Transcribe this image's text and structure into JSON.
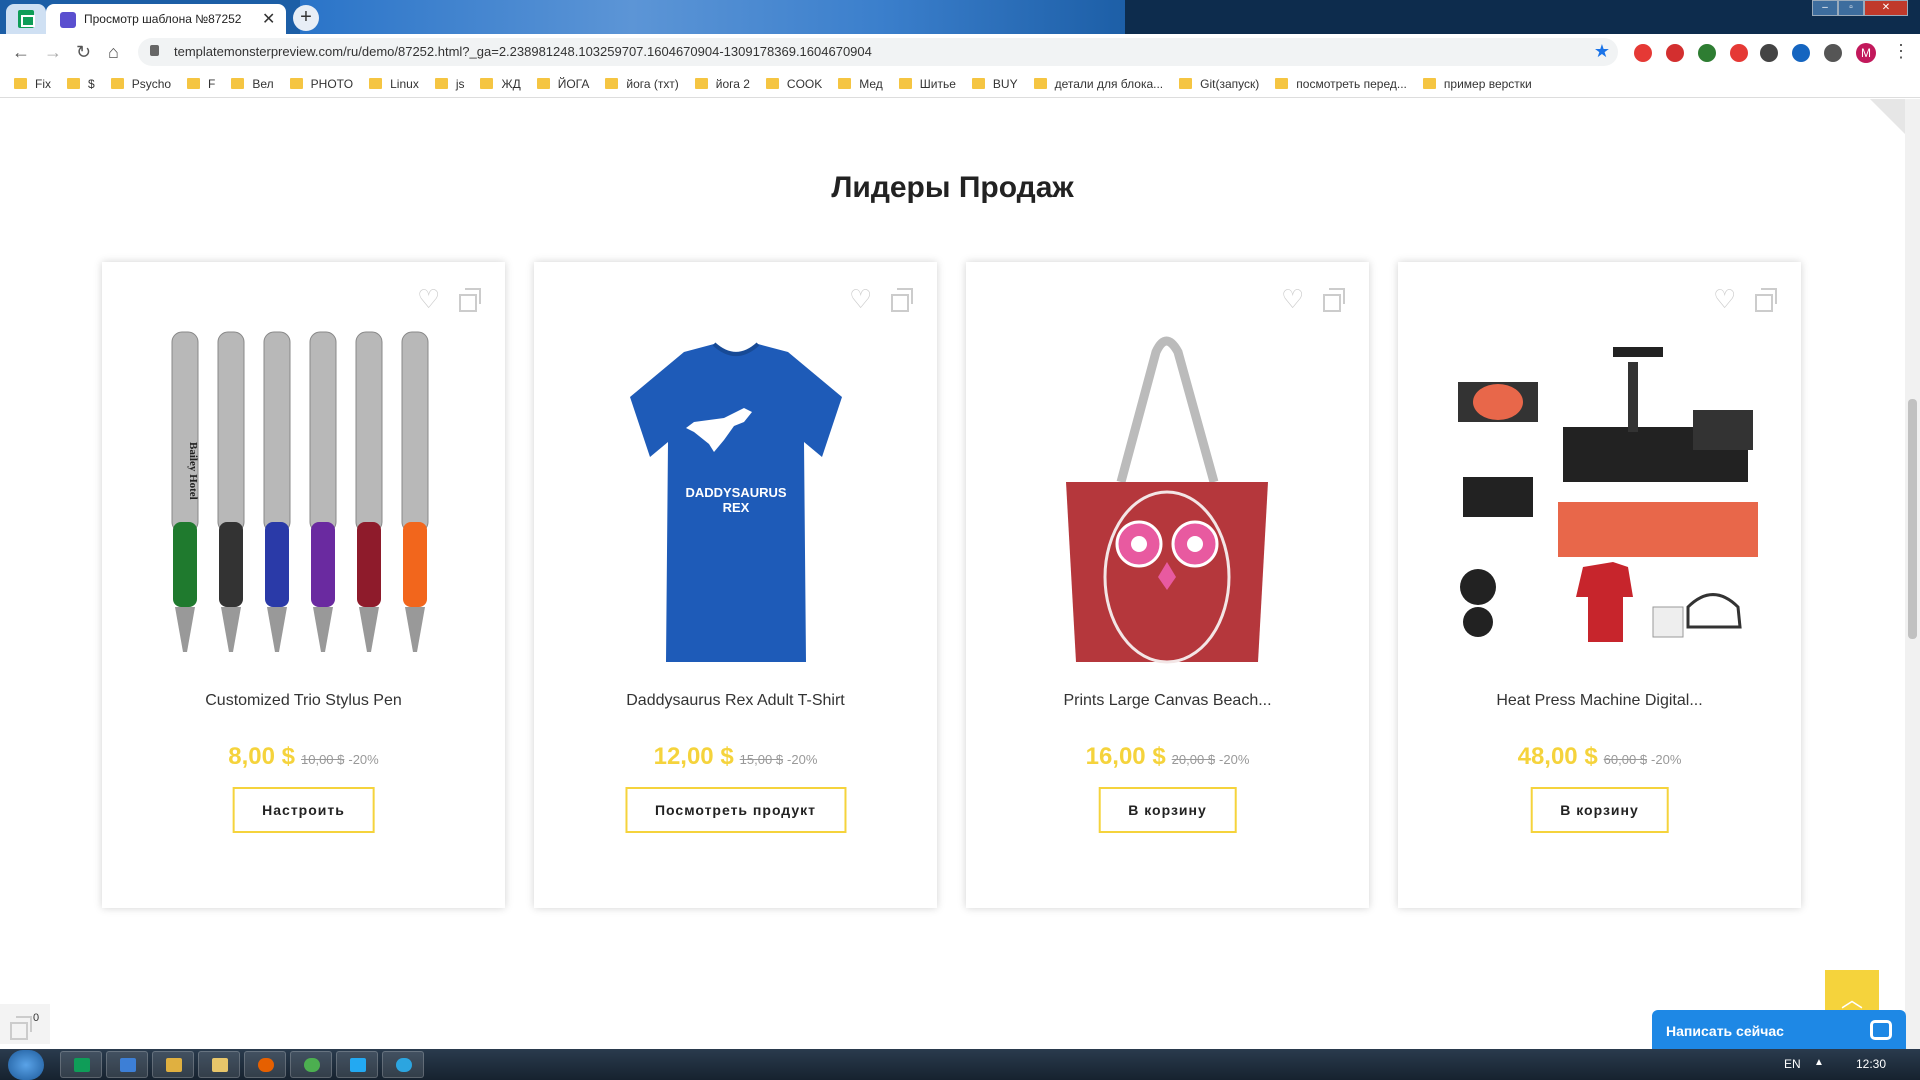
{
  "browser": {
    "tab_title": "Просмотр шаблона №87252",
    "new_tab": "+",
    "url": "templatemonsterpreview.com/ru/demo/87252.html?_ga=2.238981248.103259707.1604670904-1309178369.1604670904",
    "profile_initial": "M"
  },
  "bookmarks": [
    "Fix",
    "$",
    "Psycho",
    "F",
    "Вел",
    "PHOTO",
    "Linux",
    "js",
    "ЖД",
    "ЙОГА",
    "йога (тхт)",
    "йога 2",
    "COOK",
    "Мед",
    "Шитье",
    "BUY",
    "детали для блока...",
    "Git(запуск)",
    "посмотреть перед...",
    "пример верстки"
  ],
  "section": {
    "title": "Лидеры Продаж"
  },
  "products": [
    {
      "name": "Customized Trio Stylus Pen",
      "price": "8,00 $",
      "old_price": "10,00 $",
      "discount": "-20%",
      "button": "Настроить"
    },
    {
      "name": "Daddysaurus Rex Adult T-Shirt",
      "price": "12,00 $",
      "old_price": "15,00 $",
      "discount": "-20%",
      "button": "Посмотреть продукт"
    },
    {
      "name": "Prints Large Canvas Beach...",
      "price": "16,00 $",
      "old_price": "20,00 $",
      "discount": "-20%",
      "button": "В корзину"
    },
    {
      "name": "Heat Press Machine Digital...",
      "price": "48,00 $",
      "old_price": "60,00 $",
      "discount": "-20%",
      "button": "В корзину"
    }
  ],
  "tshirt_print": {
    "line1": "DADDYSAURUS",
    "line2": "REX"
  },
  "pen_print": "Bailey Hotel",
  "compare_count": "0",
  "chat": {
    "label": "Написать сейчас"
  },
  "taskbar": {
    "lang": "EN",
    "time": "12:30"
  },
  "colors": {
    "accent": "#f5d33c",
    "chat": "#1e88e5"
  }
}
